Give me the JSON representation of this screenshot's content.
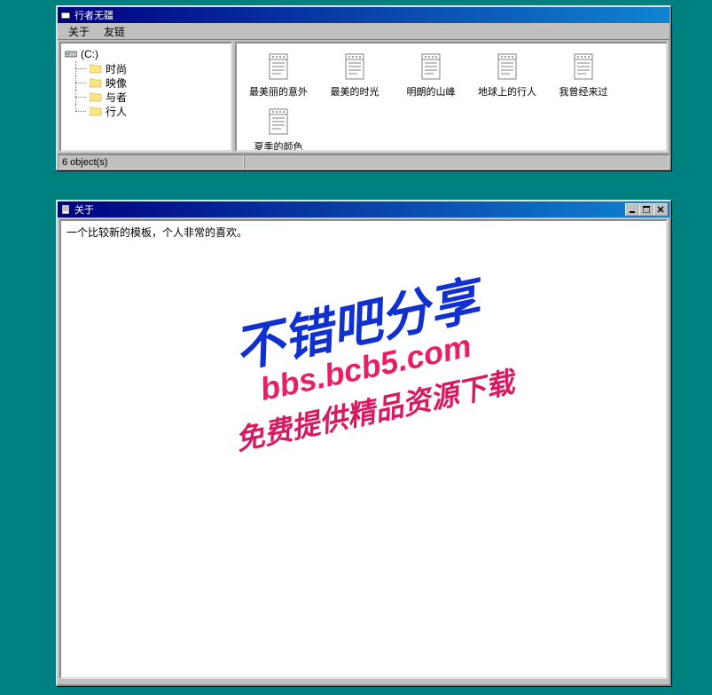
{
  "window1": {
    "title": "行者无疆",
    "menu": [
      "关于",
      "友链"
    ],
    "tree": {
      "root": "(C:)",
      "children": [
        "时尚",
        "映像",
        "与者",
        "行人"
      ]
    },
    "files": [
      "最美丽的意外",
      "最美的时光",
      "明朗的山峰",
      "地球上的行人",
      "我曾经来过",
      "夏季的颜色"
    ],
    "status": "6 object(s)"
  },
  "window2": {
    "title": "关于",
    "description": "一个比较新的模板，个人非常的喜欢。",
    "watermark": {
      "line1": "不错吧分享",
      "line2": "bbs.bcb5.com",
      "line3": "免费提供精品资源下载"
    }
  }
}
